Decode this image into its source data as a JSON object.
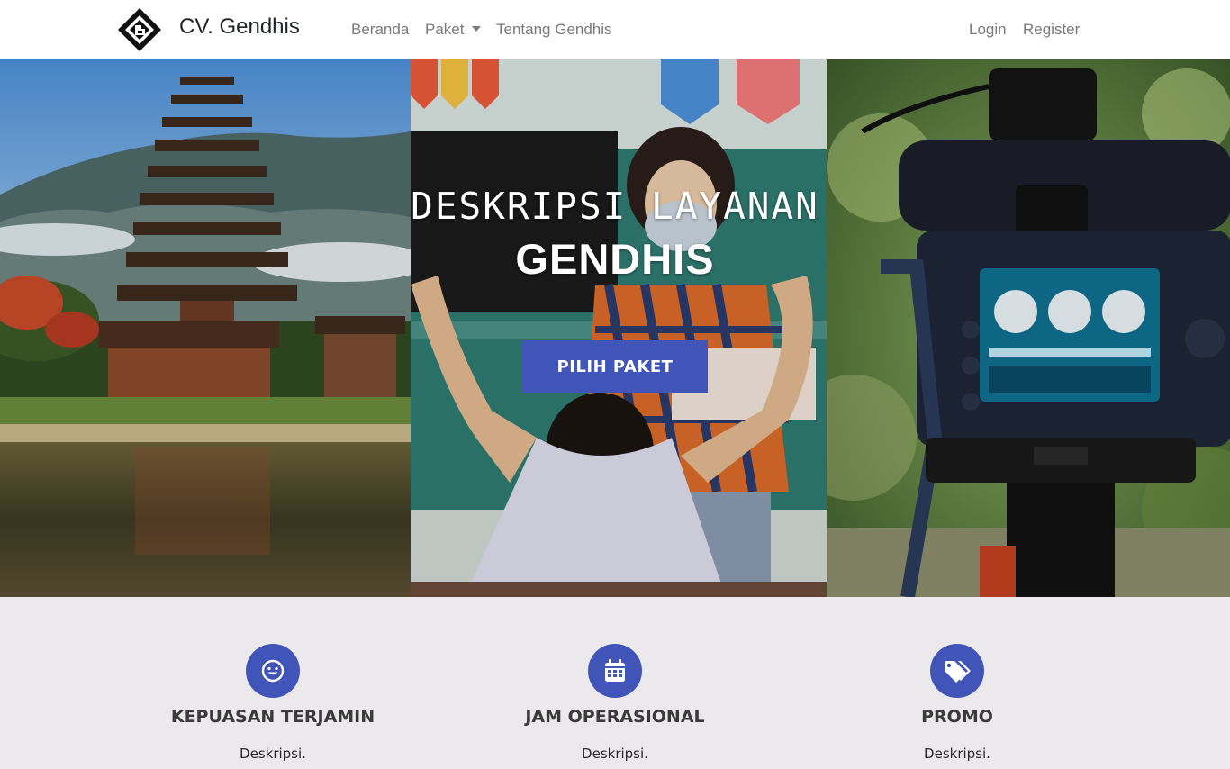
{
  "navbar": {
    "brand_name": "CV. Gendhis",
    "logo_icon": "diamond-g-logo",
    "links": {
      "home": "Beranda",
      "package": "Paket",
      "about": "Tentang Gendhis",
      "login": "Login",
      "register": "Register"
    }
  },
  "hero": {
    "title_line1": "DESKRIPSI LAYANAN",
    "title_line2": "GENDHIS",
    "cta_label": "PILIH PAKET",
    "panels": [
      "temple-photo",
      "classroom-photo",
      "camera-photo"
    ]
  },
  "features": [
    {
      "icon": "smile-icon",
      "title": "KEPUASAN TERJAMIN",
      "description": "Deskripsi."
    },
    {
      "icon": "calendar-icon",
      "title": "JAM OPERASIONAL",
      "description": "Deskripsi."
    },
    {
      "icon": "tags-icon",
      "title": "PROMO",
      "description": "Deskripsi."
    }
  ],
  "colors": {
    "accent": "#4154b8",
    "features_bg": "#ebe9eb",
    "nav_text": "#7a7a7a"
  }
}
